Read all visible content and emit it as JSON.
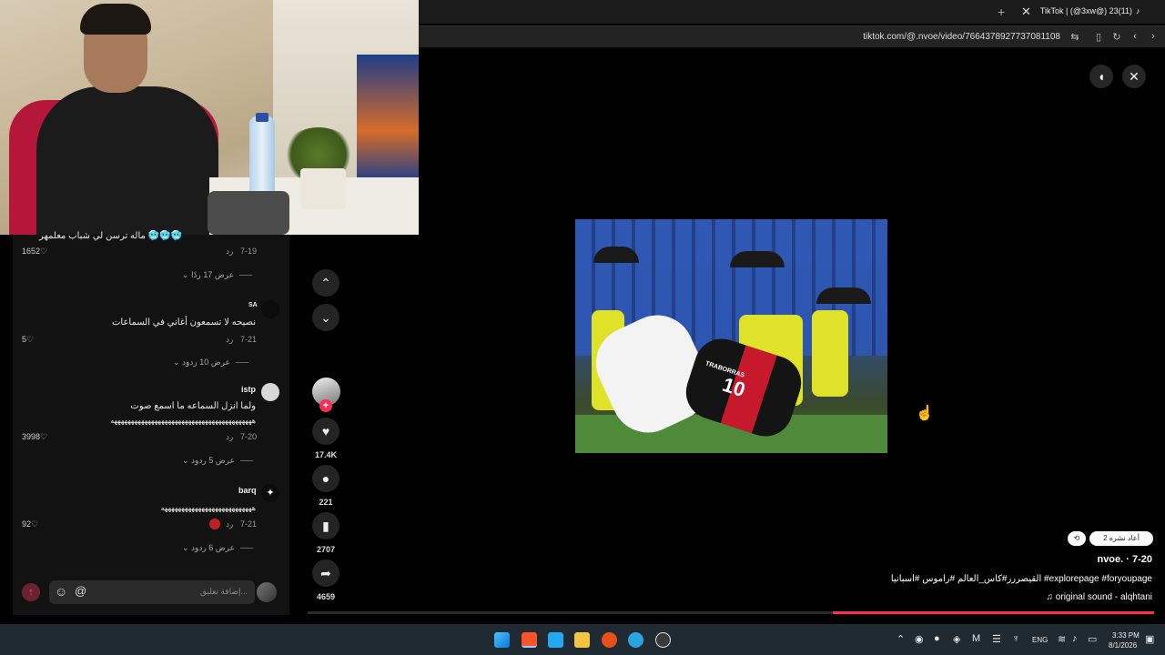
{
  "browser": {
    "tab_title": "TikTok | (@3xw@) 23(11)",
    "url": "tiktok.com/@.nvoe/video/7664378927737081108"
  },
  "comments": [
    {
      "text_partial": "ماله ترسن لي شباب معلمهر 🥶🥶🥶",
      "date": "7-19",
      "reply": "رد",
      "likes": "1652",
      "replies": "عرض 17 ردًا"
    },
    {
      "user": "SA",
      "text": "نصيحه لا تسمعون أغاني في السماعات",
      "date": "7-21",
      "reply": "رد",
      "likes": "5",
      "replies": "عرض 10 ردود"
    },
    {
      "user": "istp",
      "text": "ولما انزل السماعه ما اسمع صوت",
      "text2": "ههههههههههههههههههههههههههههههههههههههههههه",
      "date": "7-20",
      "reply": "رد",
      "likes": "3998",
      "replies": "عرض 5 ردود"
    },
    {
      "user": "barq",
      "text": "هههههههههههههههههههههههههههه",
      "date": "7-21",
      "reply": "رد",
      "likes": "92",
      "replies": "عرض 6 ردود"
    }
  ],
  "comment_bar": {
    "placeholder": "إضافة تعليق...",
    "emoji": "☺",
    "mention": "@"
  },
  "actions": {
    "likes": "17.4K",
    "comments": "221",
    "saves": "2707",
    "shares": "4659"
  },
  "video": {
    "jersey_text": "TRABORRAS",
    "jersey_number": "10"
  },
  "caption": {
    "pill_repost": "2 أعاد نشره",
    "author": "nvoe. · 7-20",
    "description": "القيصررر#كاس_العالم #راموس #اسبانيا #explorepage #foryoupage",
    "sound": "♫ original sound - alqhtani",
    "progress": 0.38
  },
  "taskbar": {
    "lang": "ENG",
    "time": "3:33 PM",
    "date": "8/1/2026"
  },
  "colors": {
    "accent": "#fe2c55",
    "panel": "#121212",
    "taskbar": "#1f2a33"
  }
}
